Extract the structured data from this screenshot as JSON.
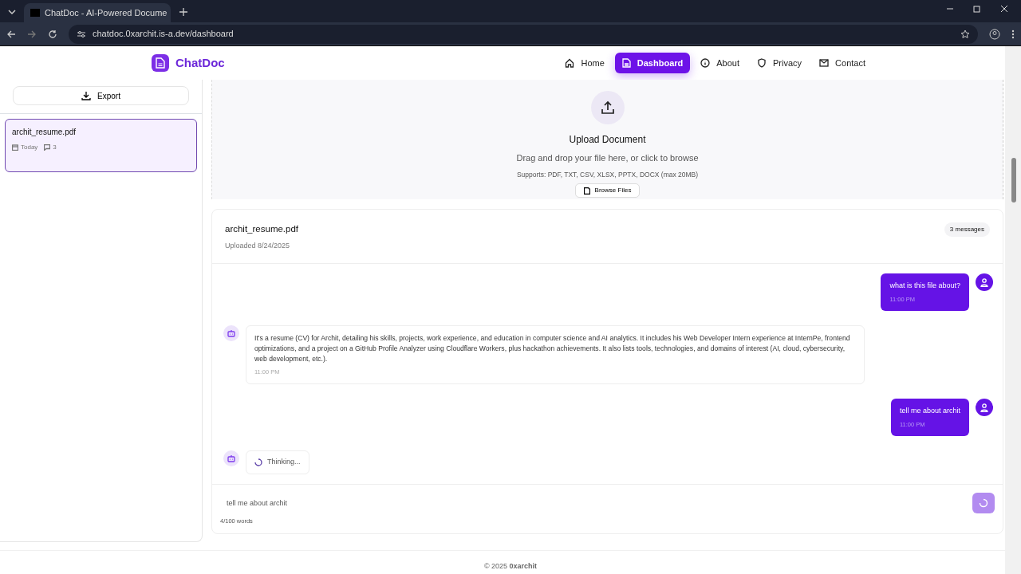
{
  "browser": {
    "tab_title": "ChatDoc - AI-Powered Docume",
    "url": "chatdoc.0xarchit.is-a.dev/dashboard"
  },
  "header": {
    "brand": "ChatDoc",
    "nav": [
      {
        "label": "Home",
        "selected": false
      },
      {
        "label": "Dashboard",
        "selected": true
      },
      {
        "label": "About",
        "selected": false
      },
      {
        "label": "Privacy",
        "selected": false
      },
      {
        "label": "Contact",
        "selected": false
      }
    ]
  },
  "sidebar": {
    "export_button": "Export",
    "documents": [
      {
        "name": "archit_resume.pdf",
        "date": "Today",
        "message_count": "3",
        "selected": true
      }
    ]
  },
  "upload": {
    "title": "Upload Document",
    "hint": "Drag and drop your file here, or click to browse",
    "supports": "Supports: PDF, TXT, CSV, XLSX, PPTX, DOCX (max 20MB)",
    "browse_button": "Browse Files"
  },
  "chat": {
    "document_name": "archit_resume.pdf",
    "uploaded": "Uploaded 8/24/2025",
    "message_count": "3 messages",
    "messages": [
      {
        "kind": "user",
        "text": "what is this file about?",
        "time": "11:00 PM"
      },
      {
        "kind": "assistant",
        "text": "It's a resume (CV) for Archit, detailing his skills, projects, work experience, and education in computer science and AI analytics. It includes his Web Developer Intern experience at InternPe, frontend optimizations, and a project on a GitHub Profile Analyzer using Cloudflare Workers, plus hackathon achievements. It also lists tools, technologies, and domains of interest (AI, cloud, cybersecurity, web development, etc.).",
        "time": "11:00 PM"
      },
      {
        "kind": "user",
        "text": "tell me about archit",
        "time": "11:00 PM"
      },
      {
        "kind": "thinking",
        "text": "Thinking..."
      }
    ],
    "input": {
      "value": "tell me about archit"
    },
    "word_count": "4/100 words"
  },
  "footer": "© 2025 **0xarchit**"
}
